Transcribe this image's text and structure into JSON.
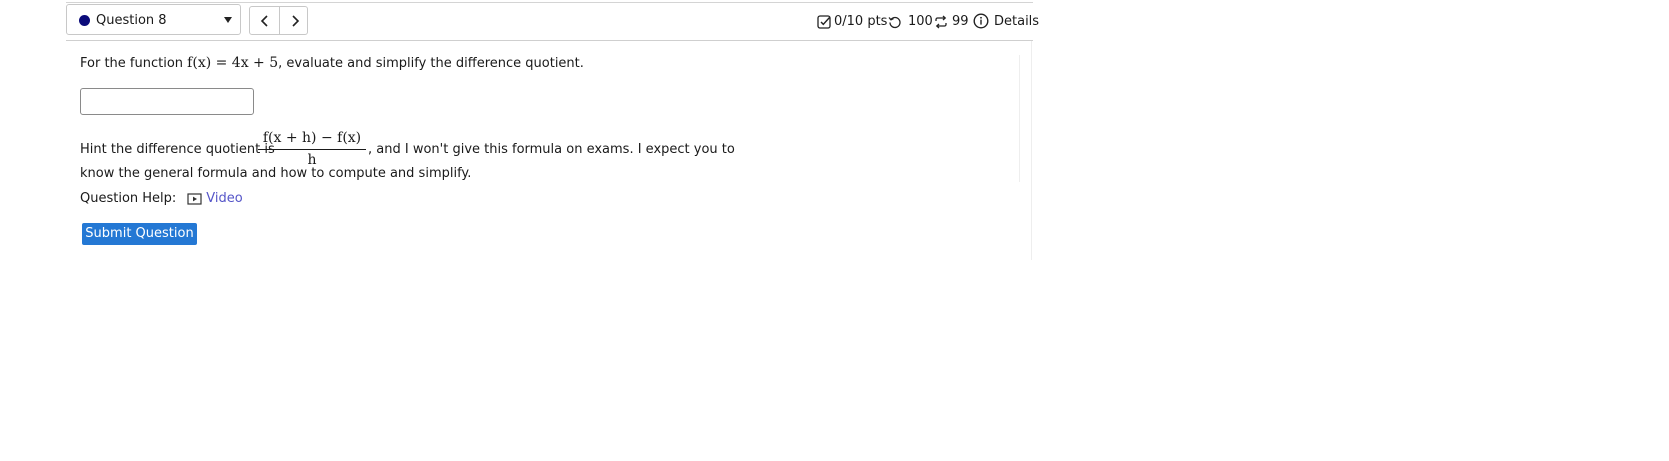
{
  "header": {
    "question_label": "Question 8",
    "points": "0/10 pts",
    "attempts": "100",
    "retries": "99",
    "details": "Details"
  },
  "question": {
    "intro": "For the function",
    "function": "f(x) = 4x + 5",
    "task": ", evaluate and simplify the difference quotient.",
    "answer_value": "",
    "hint_before": "Hint the difference quotient is",
    "hint_numerator": "f(x + h) − f(x)",
    "hint_denominator": "h",
    "hint_after": ", and I won't give this formula on exams. I expect you to",
    "hint_line2": "know the general formula and how to compute and simplify."
  },
  "help": {
    "label": "Question Help:",
    "video_label": "Video"
  },
  "submit_label": "Submit Question",
  "colors": {
    "accent": "#2478d4",
    "link": "#5555c8",
    "status_dot": "#0b0b7a"
  },
  "icons": [
    "chevron-down-icon",
    "chevron-left-icon",
    "chevron-right-icon",
    "checkbox-icon",
    "history-icon",
    "retry-icon",
    "info-icon",
    "video-icon"
  ]
}
